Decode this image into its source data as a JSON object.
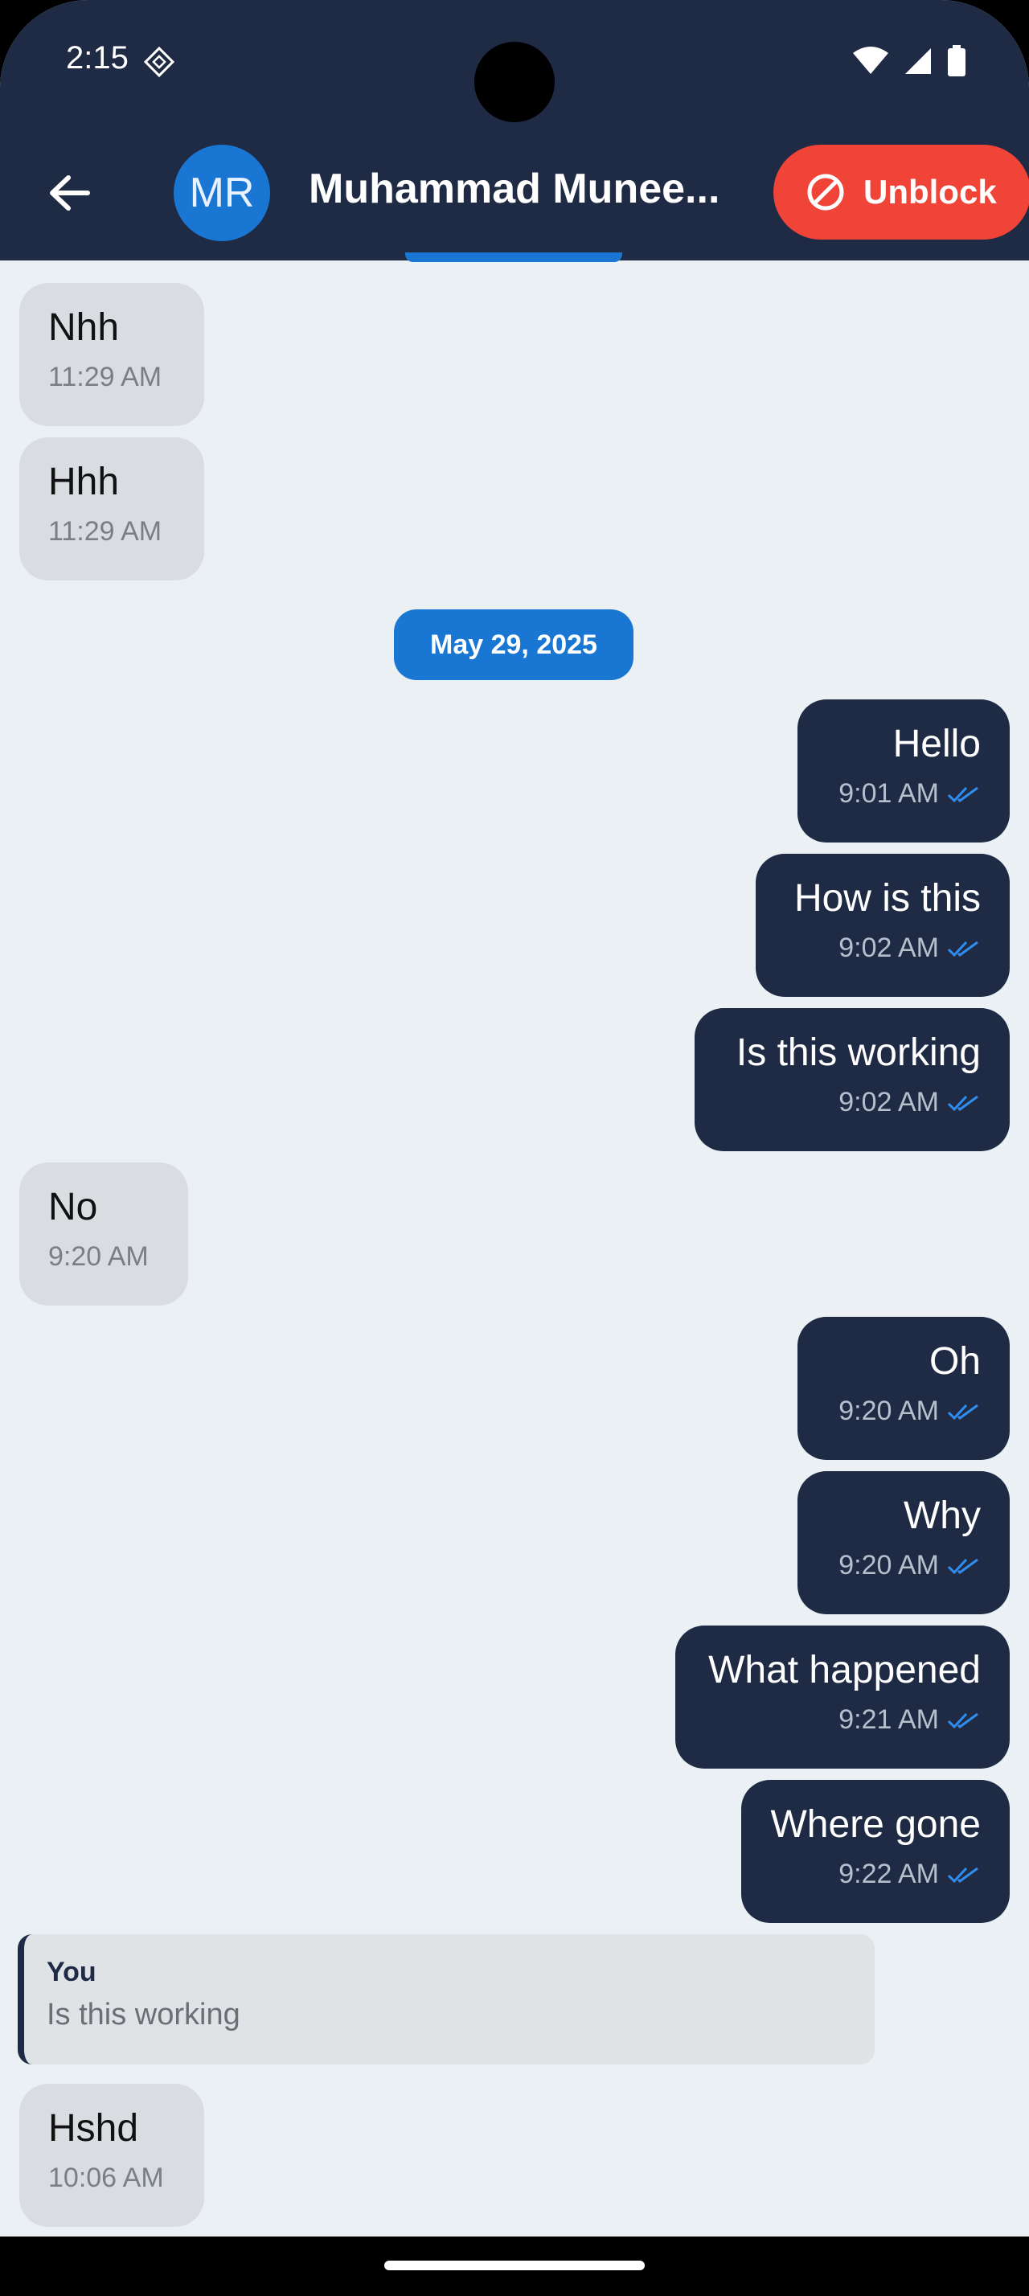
{
  "status_bar": {
    "time": "2:15"
  },
  "header": {
    "avatar_initials": "MR",
    "contact_name": "Muhammad Munee...",
    "unblock_label": "Unblock"
  },
  "messages": [
    {
      "text": "Nhh",
      "time": "11:29 AM",
      "direction": "in"
    },
    {
      "text": "Hhh",
      "time": "11:29 AM",
      "direction": "in"
    },
    {
      "text": "Hello",
      "time": "9:01 AM",
      "direction": "out"
    },
    {
      "text": "How is this",
      "time": "9:02 AM",
      "direction": "out"
    },
    {
      "text": "Is this working",
      "time": "9:02 AM",
      "direction": "out"
    },
    {
      "text": "No",
      "time": "9:20 AM",
      "direction": "in"
    },
    {
      "text": "Oh",
      "time": "9:20 AM",
      "direction": "out"
    },
    {
      "text": "Why",
      "time": "9:20 AM",
      "direction": "out"
    },
    {
      "text": "What happened",
      "time": "9:21 AM",
      "direction": "out"
    },
    {
      "text": "Where gone",
      "time": "9:22 AM",
      "direction": "out"
    },
    {
      "text": "Hshd",
      "time": "10:06 AM",
      "direction": "in"
    }
  ],
  "date_separator": "May 29, 2025",
  "reply_preview": {
    "author": "You",
    "text": "Is this working"
  },
  "colors": {
    "app_bar": "#1f2a44",
    "background": "#eaf0f3",
    "accent": "#1976d2",
    "unblock": "#f04438",
    "incoming_bubble": "#d9dde2",
    "outgoing_bubble": "#1f2a44"
  }
}
